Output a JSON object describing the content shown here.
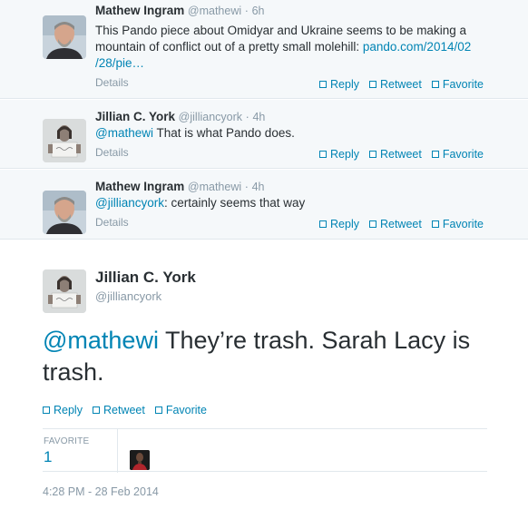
{
  "actions": {
    "reply": "Reply",
    "retweet": "Retweet",
    "favorite": "Favorite"
  },
  "conversation": [
    {
      "fullname": "Mathew Ingram",
      "username": "@mathewi",
      "separator": "·",
      "time": "6h",
      "text_line1": "This Pando piece about Omidyar and Ukraine seems to be making a",
      "text_line2_prefix": "mountain of conflict out of a pretty small molehill: ",
      "link_part1": "pando.com/2014/02",
      "link_part2": "/28/pie…",
      "details": "Details"
    },
    {
      "fullname": "Jillian C. York",
      "username": "@jilliancyork",
      "separator": "·",
      "time": "4h",
      "mention": "@mathewi",
      "text": " That is what Pando does.",
      "details": "Details"
    },
    {
      "fullname": "Mathew Ingram",
      "username": "@mathewi",
      "separator": "·",
      "time": "4h",
      "mention": "@jilliancyork",
      "text": ": certainly seems that way",
      "details": "Details"
    }
  ],
  "focus_tweet": {
    "fullname": "Jillian C. York",
    "username": "@jilliancyork",
    "mention": "@mathewi",
    "text_rest": " They’re trash. Sarah Lacy is trash.",
    "stats": {
      "favorites_label": "FAVORITE",
      "favorites_count": "1"
    },
    "timestamp": "4:28 PM - 28 Feb 2014"
  },
  "colors": {
    "link": "#0084b4",
    "muted": "#8899a6",
    "reply_bg": "#f5f8fa",
    "border": "#e1e8ed"
  }
}
